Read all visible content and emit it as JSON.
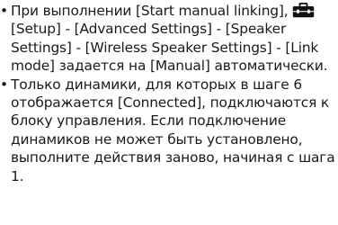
{
  "notes": [
    {
      "part1": "При выполнении [Start manual linking],",
      "icon": "toolbox-icon",
      "part2": "[Setup] - [Advanced Settings] - [Speaker Settings] - [Wireless Speaker Settings] - [Link mode] задается на [Manual] автоматически."
    },
    {
      "text": "Только динамики, для которых в шаге 6 отображается [Connected], подключаются к блоку управления. Если подключение динамиков не может быть установлено, выполните действия заново, начиная с шага 1."
    }
  ]
}
